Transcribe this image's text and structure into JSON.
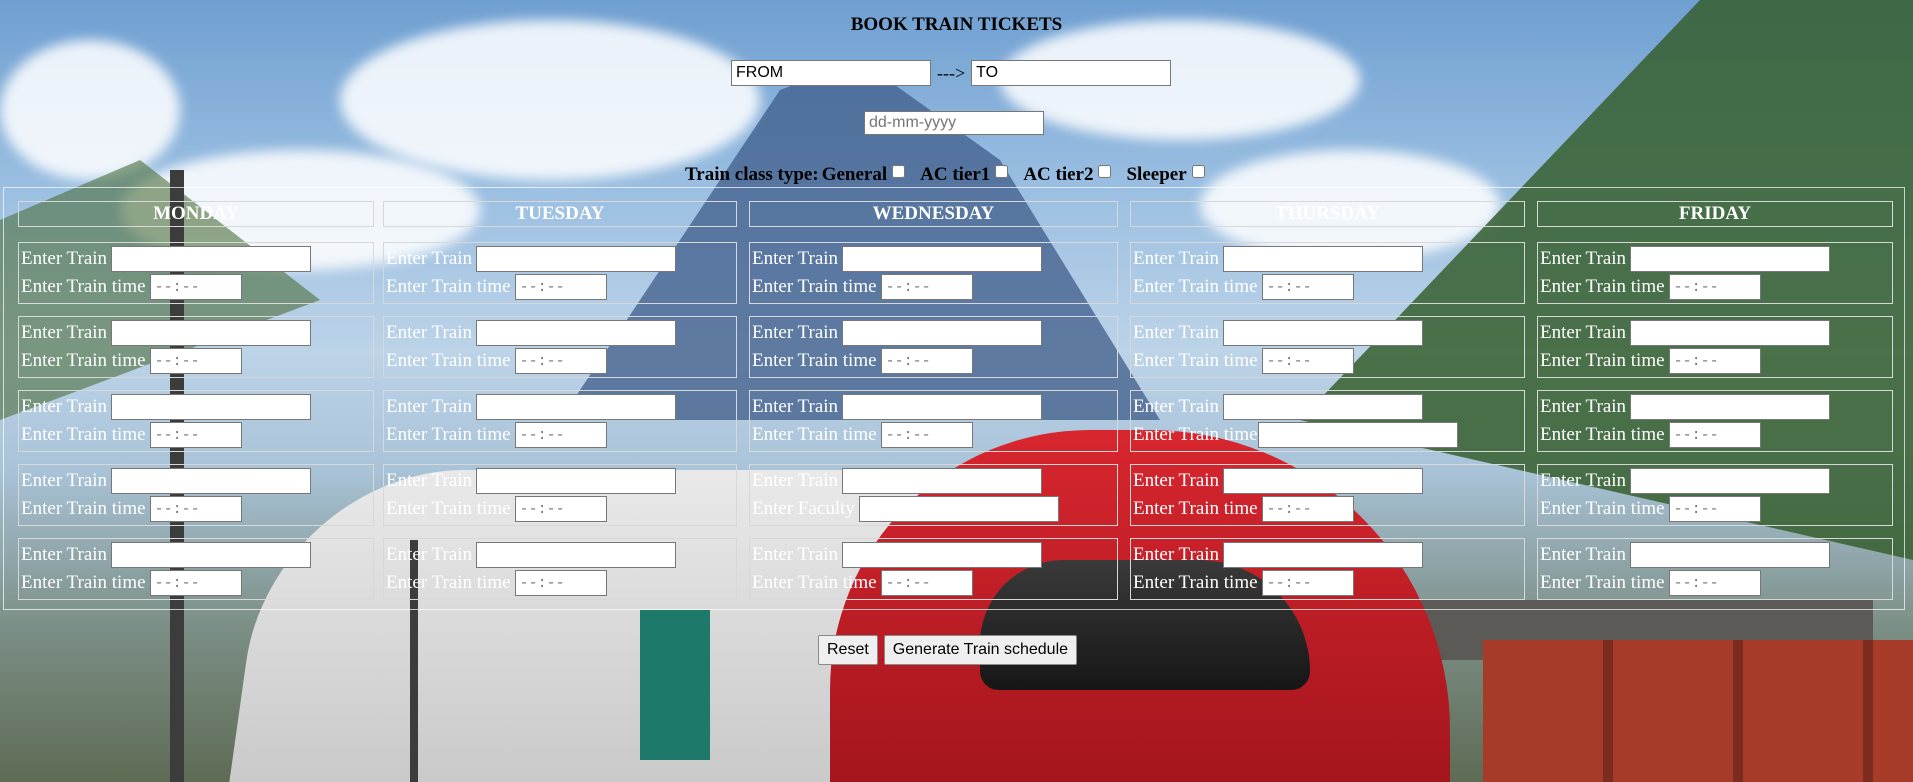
{
  "title": "BOOK TRAIN TICKETS",
  "route": {
    "from_value": "FROM",
    "arrow": "--->",
    "to_value": "TO"
  },
  "date": {
    "placeholder": "dd-mm-yyyy"
  },
  "train_class": {
    "label": "Train class type:",
    "options": [
      "General",
      "AC tier1",
      "AC tier2",
      "Sleeper"
    ]
  },
  "schedule": {
    "train_label": "Enter Train",
    "time_label": "Enter Train time",
    "time_placeholder": "--:--",
    "days": [
      "MONDAY",
      "TUESDAY",
      "WEDNESDAY",
      "THURSDAY",
      "FRIDAY"
    ],
    "obscured_label": "Enter Faculty"
  },
  "buttons": {
    "reset": "Reset",
    "generate": "Generate Train schedule"
  }
}
